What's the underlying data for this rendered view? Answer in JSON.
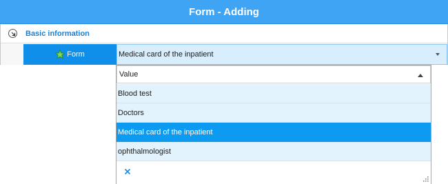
{
  "window": {
    "title": "Form - Adding"
  },
  "group": {
    "title": "Basic information",
    "icon": "collapse-circle-arrow-icon"
  },
  "field": {
    "label": "Form",
    "icon": "star-icon",
    "value": "Medical card of the inpatient",
    "accent_color": "#0f8fea"
  },
  "dropdown": {
    "column_header": "Value",
    "sort": "ascending",
    "items": [
      {
        "label": "Blood test",
        "selected": false
      },
      {
        "label": "Doctors",
        "selected": false
      },
      {
        "label": "Medical card of the inpatient",
        "selected": true
      },
      {
        "label": "ophthalmologist",
        "selected": false
      }
    ],
    "clear_icon": "clear-x-icon",
    "resize_icon": "resize-grip-icon",
    "selected_color": "#0d9bf2",
    "item_color": "#e2f3fe"
  },
  "colors": {
    "title_bar": "#40a4f4",
    "group_title": "#1e7fd1"
  }
}
